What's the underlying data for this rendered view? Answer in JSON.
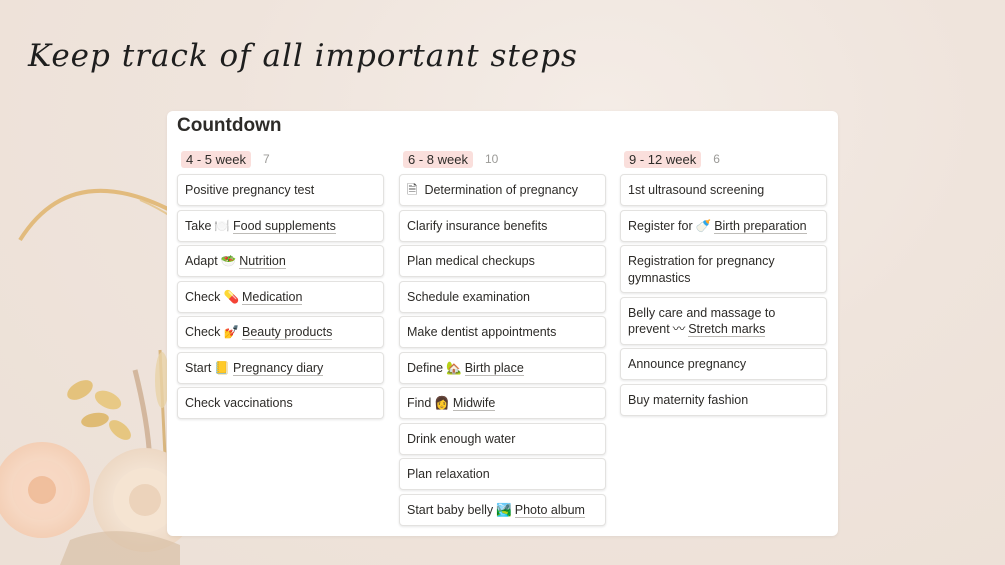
{
  "headline": "Keep track of all important steps",
  "board": {
    "title": "Countdown",
    "columns": [
      {
        "label": "4 - 5 week",
        "count": "7",
        "label_bg": "#fadfdc",
        "cards": [
          {
            "prefix": "Positive pregnancy test"
          },
          {
            "prefix": "Take",
            "icon": "plate-cutlery-icon",
            "glyph": "🍽️",
            "link": "Food supplements"
          },
          {
            "prefix": "Adapt",
            "icon": "salad-icon",
            "glyph": "🥗",
            "link": "Nutrition"
          },
          {
            "prefix": "Check",
            "icon": "pill-icon",
            "glyph": "💊",
            "link": "Medication"
          },
          {
            "prefix": "Check",
            "icon": "nail-polish-icon",
            "glyph": "💅",
            "link": "Beauty products"
          },
          {
            "prefix": "Start",
            "icon": "notepad-icon",
            "glyph": "📒",
            "link": "Pregnancy diary"
          },
          {
            "prefix": "Check vaccinations"
          }
        ]
      },
      {
        "label": "6 - 8 week",
        "count": "10",
        "label_bg": "#fadfdc",
        "cards": [
          {
            "prefix": "Determination of pregnancy",
            "doc_icon": true
          },
          {
            "prefix": "Clarify insurance benefits"
          },
          {
            "prefix": "Plan medical checkups"
          },
          {
            "prefix": "Schedule examination"
          },
          {
            "prefix": "Make dentist appointments"
          },
          {
            "prefix": "Define",
            "icon": "house-icon",
            "glyph": "🏡",
            "link": "Birth place"
          },
          {
            "prefix": "Find",
            "icon": "woman-icon",
            "glyph": "👩",
            "link": "Midwife"
          },
          {
            "prefix": "Drink enough water"
          },
          {
            "prefix": "Plan relaxation"
          },
          {
            "prefix": "Start baby belly",
            "icon": "photo-album-icon",
            "glyph": "🏞️",
            "link": "Photo album"
          }
        ]
      },
      {
        "label": "9 - 12 week",
        "count": "6",
        "label_bg": "#fadfdc",
        "cards": [
          {
            "prefix": "1st ultrasound screening"
          },
          {
            "prefix": "Register for",
            "icon": "baby-bottle-icon",
            "glyph": "🍼",
            "link": "Birth preparation"
          },
          {
            "prefix": "Registration for pregnancy gymnastics",
            "tall": true
          },
          {
            "prefix": "Belly care and massage to prevent",
            "icon": "wave-icon",
            "glyph": "〰",
            "link": "Stretch marks",
            "tall": true
          },
          {
            "prefix": "Announce pregnancy"
          },
          {
            "prefix": "Buy maternity fashion"
          }
        ]
      }
    ]
  },
  "colors": {
    "background": "#efe4dc",
    "panel": "#ffffff",
    "tag": "#fadfdc",
    "text": "#2d2b28",
    "muted": "#9b9a97"
  }
}
